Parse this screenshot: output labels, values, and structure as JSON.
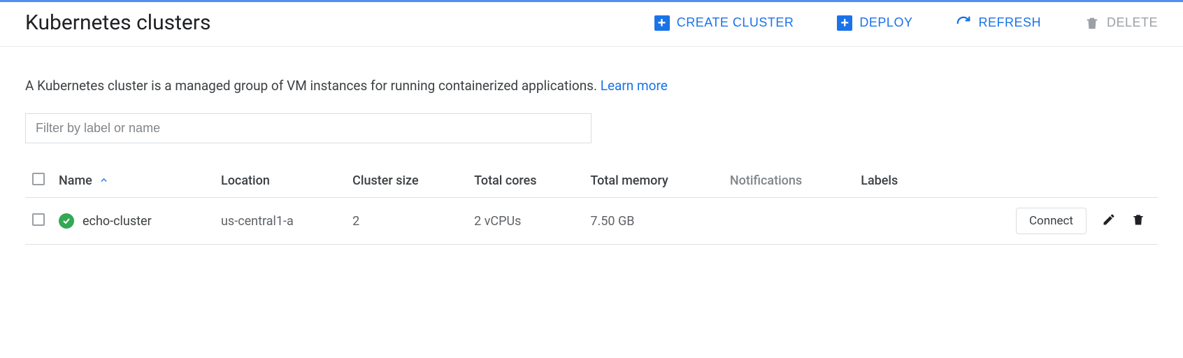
{
  "header": {
    "title": "Kubernetes clusters",
    "actions": {
      "create": "Create cluster",
      "deploy": "Deploy",
      "refresh": "Refresh",
      "delete": "Delete"
    }
  },
  "description": {
    "text": "A Kubernetes cluster is a managed group of VM instances for running containerized applications. ",
    "learn_more": "Learn more"
  },
  "filter": {
    "placeholder": "Filter by label or name"
  },
  "table": {
    "columns": {
      "name": "Name",
      "location": "Location",
      "cluster_size": "Cluster size",
      "total_cores": "Total cores",
      "total_memory": "Total memory",
      "notifications": "Notifications",
      "labels": "Labels"
    },
    "rows": [
      {
        "status": "ok",
        "name": "echo-cluster",
        "location": "us-central1-a",
        "cluster_size": "2",
        "total_cores": "2 vCPUs",
        "total_memory": "7.50 GB",
        "notifications": "",
        "labels": "",
        "connect_label": "Connect"
      }
    ]
  }
}
